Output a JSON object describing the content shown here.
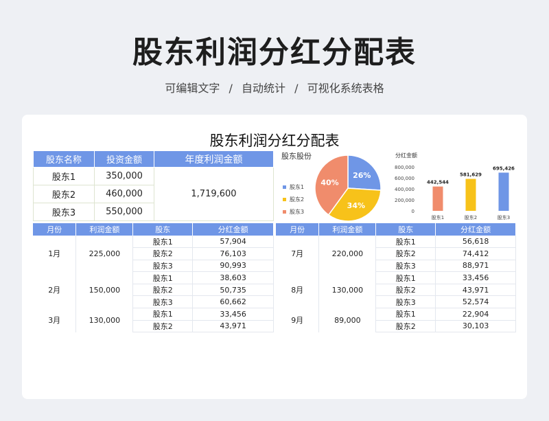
{
  "header": {
    "title": "股东利润分红分配表",
    "features": [
      "可编辑文字",
      "自动统计",
      "可视化系统表格"
    ],
    "separator": "/"
  },
  "document": {
    "title": "股东利润分红分配表",
    "shareholder_table": {
      "headers": [
        "股东名称",
        "投资金额",
        "年度利润金额"
      ],
      "rows": [
        {
          "name": "股东1",
          "investment": "350,000"
        },
        {
          "name": "股东2",
          "investment": "460,000"
        },
        {
          "name": "股东3",
          "investment": "550,000"
        }
      ],
      "annual_profit": "1,719,600"
    },
    "monthly_headers": [
      "月份",
      "利润金额",
      "股东",
      "分红金额"
    ],
    "monthly_left": [
      {
        "month": "1月",
        "profit": "225,000",
        "rows": [
          [
            "股东1",
            "57,904"
          ],
          [
            "股东2",
            "76,103"
          ],
          [
            "股东3",
            "90,993"
          ]
        ]
      },
      {
        "month": "2月",
        "profit": "150,000",
        "rows": [
          [
            "股东1",
            "38,603"
          ],
          [
            "股东2",
            "50,735"
          ],
          [
            "股东3",
            "60,662"
          ]
        ]
      },
      {
        "month": "3月",
        "profit": "130,000",
        "rows": [
          [
            "股东1",
            "33,456"
          ],
          [
            "股东2",
            "43,971"
          ]
        ]
      }
    ],
    "monthly_right": [
      {
        "month": "7月",
        "profit": "220,000",
        "rows": [
          [
            "股东1",
            "56,618"
          ],
          [
            "股东2",
            "74,412"
          ],
          [
            "股东3",
            "88,971"
          ]
        ]
      },
      {
        "month": "8月",
        "profit": "130,000",
        "rows": [
          [
            "股东1",
            "33,456"
          ],
          [
            "股东2",
            "43,971"
          ],
          [
            "股东3",
            "52,574"
          ]
        ]
      },
      {
        "month": "9月",
        "profit": "89,000",
        "rows": [
          [
            "股东1",
            "22,904"
          ],
          [
            "股东2",
            "30,103"
          ]
        ]
      }
    ]
  },
  "chart_data": [
    {
      "type": "pie",
      "title": "股东股份",
      "categories": [
        "股东1",
        "股东2",
        "股东3"
      ],
      "values": [
        26,
        34,
        40
      ],
      "labels": [
        "26%",
        "34%",
        "40%"
      ],
      "colors": [
        "#6f96e6",
        "#f7c21a",
        "#f08c6c"
      ],
      "legend": "left"
    },
    {
      "type": "bar",
      "title": "分红金额",
      "categories": [
        "股东1",
        "股东2",
        "股东3"
      ],
      "values": [
        442544,
        581629,
        695426
      ],
      "labels": [
        "442,544",
        "581,629",
        "695,426"
      ],
      "colors": [
        "#f08c6c",
        "#f7c21a",
        "#6f96e6"
      ],
      "yticks": [
        "800,000",
        "600,000",
        "400,000",
        "200,000",
        "0"
      ],
      "ylim": [
        0,
        800000
      ]
    }
  ]
}
